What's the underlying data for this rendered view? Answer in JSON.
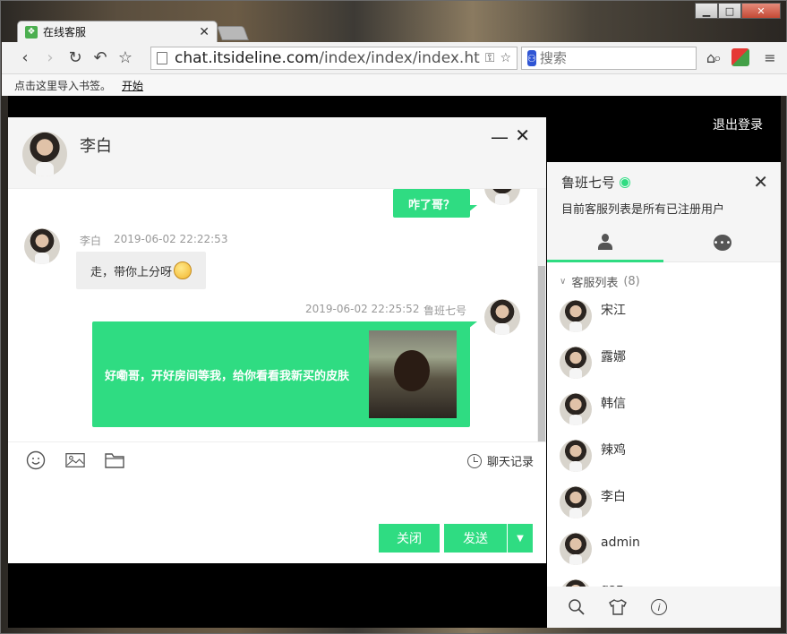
{
  "browser": {
    "tab_title": "在线客服",
    "url_host": "chat.itsideline.com",
    "url_path": "/index/index/index.html",
    "search_placeholder": "搜索",
    "bookmarks_hint": "点击这里导入书签。",
    "bookmarks_link": "开始"
  },
  "page": {
    "logout_label": "退出登录"
  },
  "chat": {
    "contact_name": "李白",
    "messages": [
      {
        "side": "right",
        "text": "咋了哥？"
      },
      {
        "side": "left",
        "sender": "李白",
        "time": "2019-06-02 22:22:53",
        "text": "走，带你上分呀"
      },
      {
        "side": "right",
        "sender": "鲁班七号",
        "time": "2019-06-02 22:25:52",
        "text": "好嘞哥，开好房间等我，给你看看我新买的皮肤"
      }
    ],
    "history_label": "聊天记录",
    "close_label": "关闭",
    "send_label": "发送"
  },
  "side": {
    "current_user": "鲁班七号",
    "description": "目前客服列表是所有已注册用户",
    "group_name": "客服列表",
    "group_count": "(8)",
    "users": [
      "宋江",
      "露娜",
      "韩信",
      "辣鸡",
      "李白",
      "admin",
      "gaz"
    ]
  },
  "colors": {
    "accent": "#2fdc82",
    "bubble_gray": "#eeeeee"
  }
}
